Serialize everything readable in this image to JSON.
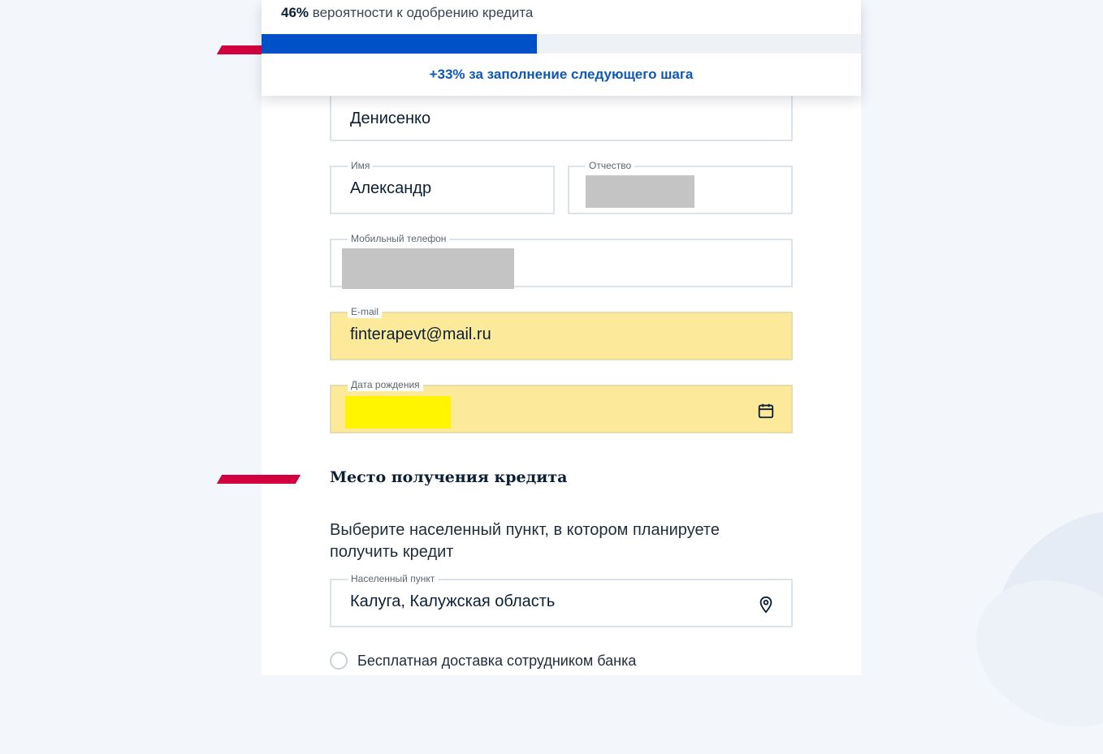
{
  "progress": {
    "percent_label": "46%",
    "text": "вероятности к одобрению кредита",
    "value": 0.46,
    "bonus": "+33% за заполнение следующего шага"
  },
  "form": {
    "surname": {
      "value": "Денисенко"
    },
    "name": {
      "label": "Имя",
      "value": "Александр"
    },
    "patronymic": {
      "label": "Отчество"
    },
    "phone": {
      "label": "Мобильный телефон"
    },
    "email": {
      "label": "E-mail",
      "value": "finterapevt@mail.ru"
    },
    "birthdate": {
      "label": "Дата рождения",
      "icon": "calendar-icon"
    }
  },
  "location_section": {
    "title": "Место получения кредита",
    "description": "Выберите населенный пункт, в котором планируете получить кредит",
    "settlement": {
      "label": "Населенный пункт",
      "value": "Калуга, Калужская область",
      "icon": "location-pin-icon"
    },
    "delivery_option": "Бесплатная доставка сотрудником банка"
  },
  "colors": {
    "accent_blue": "#0051c8",
    "bonus_text": "#0d58b5",
    "brand_red": "#d3003f",
    "autofill_bg": "#fde99a"
  }
}
